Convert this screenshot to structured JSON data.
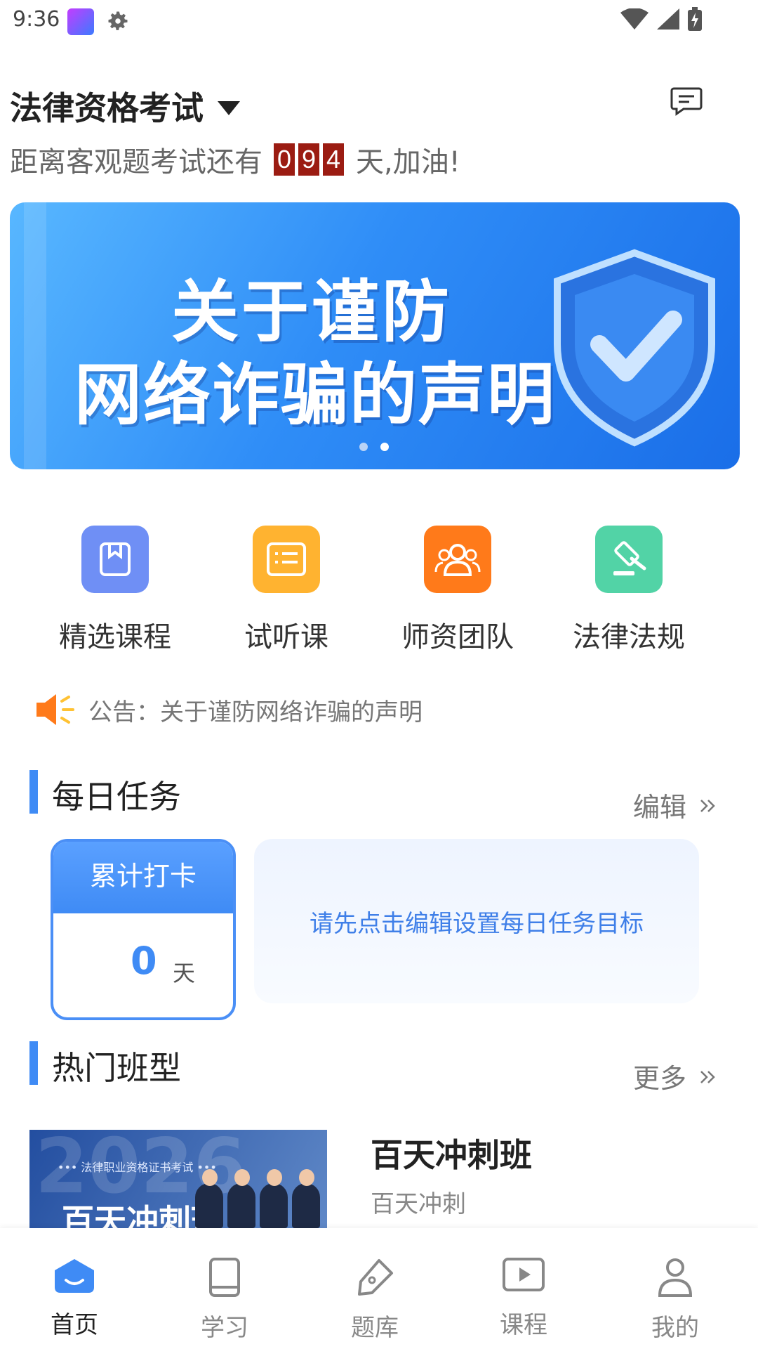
{
  "status_bar": {
    "time": "9:36"
  },
  "header": {
    "title": "法律资格考试",
    "countdown_prefix": "距离客观题考试还有",
    "countdown_digits": [
      "0",
      "9",
      "4"
    ],
    "countdown_suffix": "天,加油!"
  },
  "banner": {
    "line1": "关于谨防",
    "line2": "网络诈骗的声明",
    "page_count": 2,
    "active_page": 2
  },
  "quick_entries": [
    {
      "label": "精选课程",
      "icon": "book-icon",
      "color": "#6f8ff5"
    },
    {
      "label": "试听课",
      "icon": "list-icon",
      "color": "#ffb330"
    },
    {
      "label": "师资团队",
      "icon": "team-icon",
      "color": "#ff7a1a"
    },
    {
      "label": "法律法规",
      "icon": "gavel-icon",
      "color": "#52d3a6"
    }
  ],
  "notice": {
    "text": "公告：关于谨防网络诈骗的声明",
    "icon": "speaker-icon"
  },
  "daily_task": {
    "title": "每日任务",
    "link": "编辑",
    "checkin_label": "累计打卡",
    "checkin_count": "0",
    "checkin_unit": "天",
    "hint": "请先点击编辑设置每日任务目标"
  },
  "hot_classes": {
    "title": "热门班型",
    "link": "更多",
    "items": [
      {
        "name": "百天冲刺班",
        "desc": "百天冲刺",
        "thumb_year": "2026",
        "thumb_subtitle": "••• 法律职业资格证书考试 •••",
        "thumb_title": "百天冲刺班"
      }
    ]
  },
  "tabbar": [
    {
      "label": "首页",
      "icon": "home-icon",
      "active": true
    },
    {
      "label": "学习",
      "icon": "book-icon",
      "active": false
    },
    {
      "label": "题库",
      "icon": "pen-icon",
      "active": false
    },
    {
      "label": "课程",
      "icon": "video-icon",
      "active": false
    },
    {
      "label": "我的",
      "icon": "user-icon",
      "active": false
    }
  ],
  "colors": {
    "accent": "#3f8bf5",
    "countdown_digit_bg": "#9b1c12"
  }
}
